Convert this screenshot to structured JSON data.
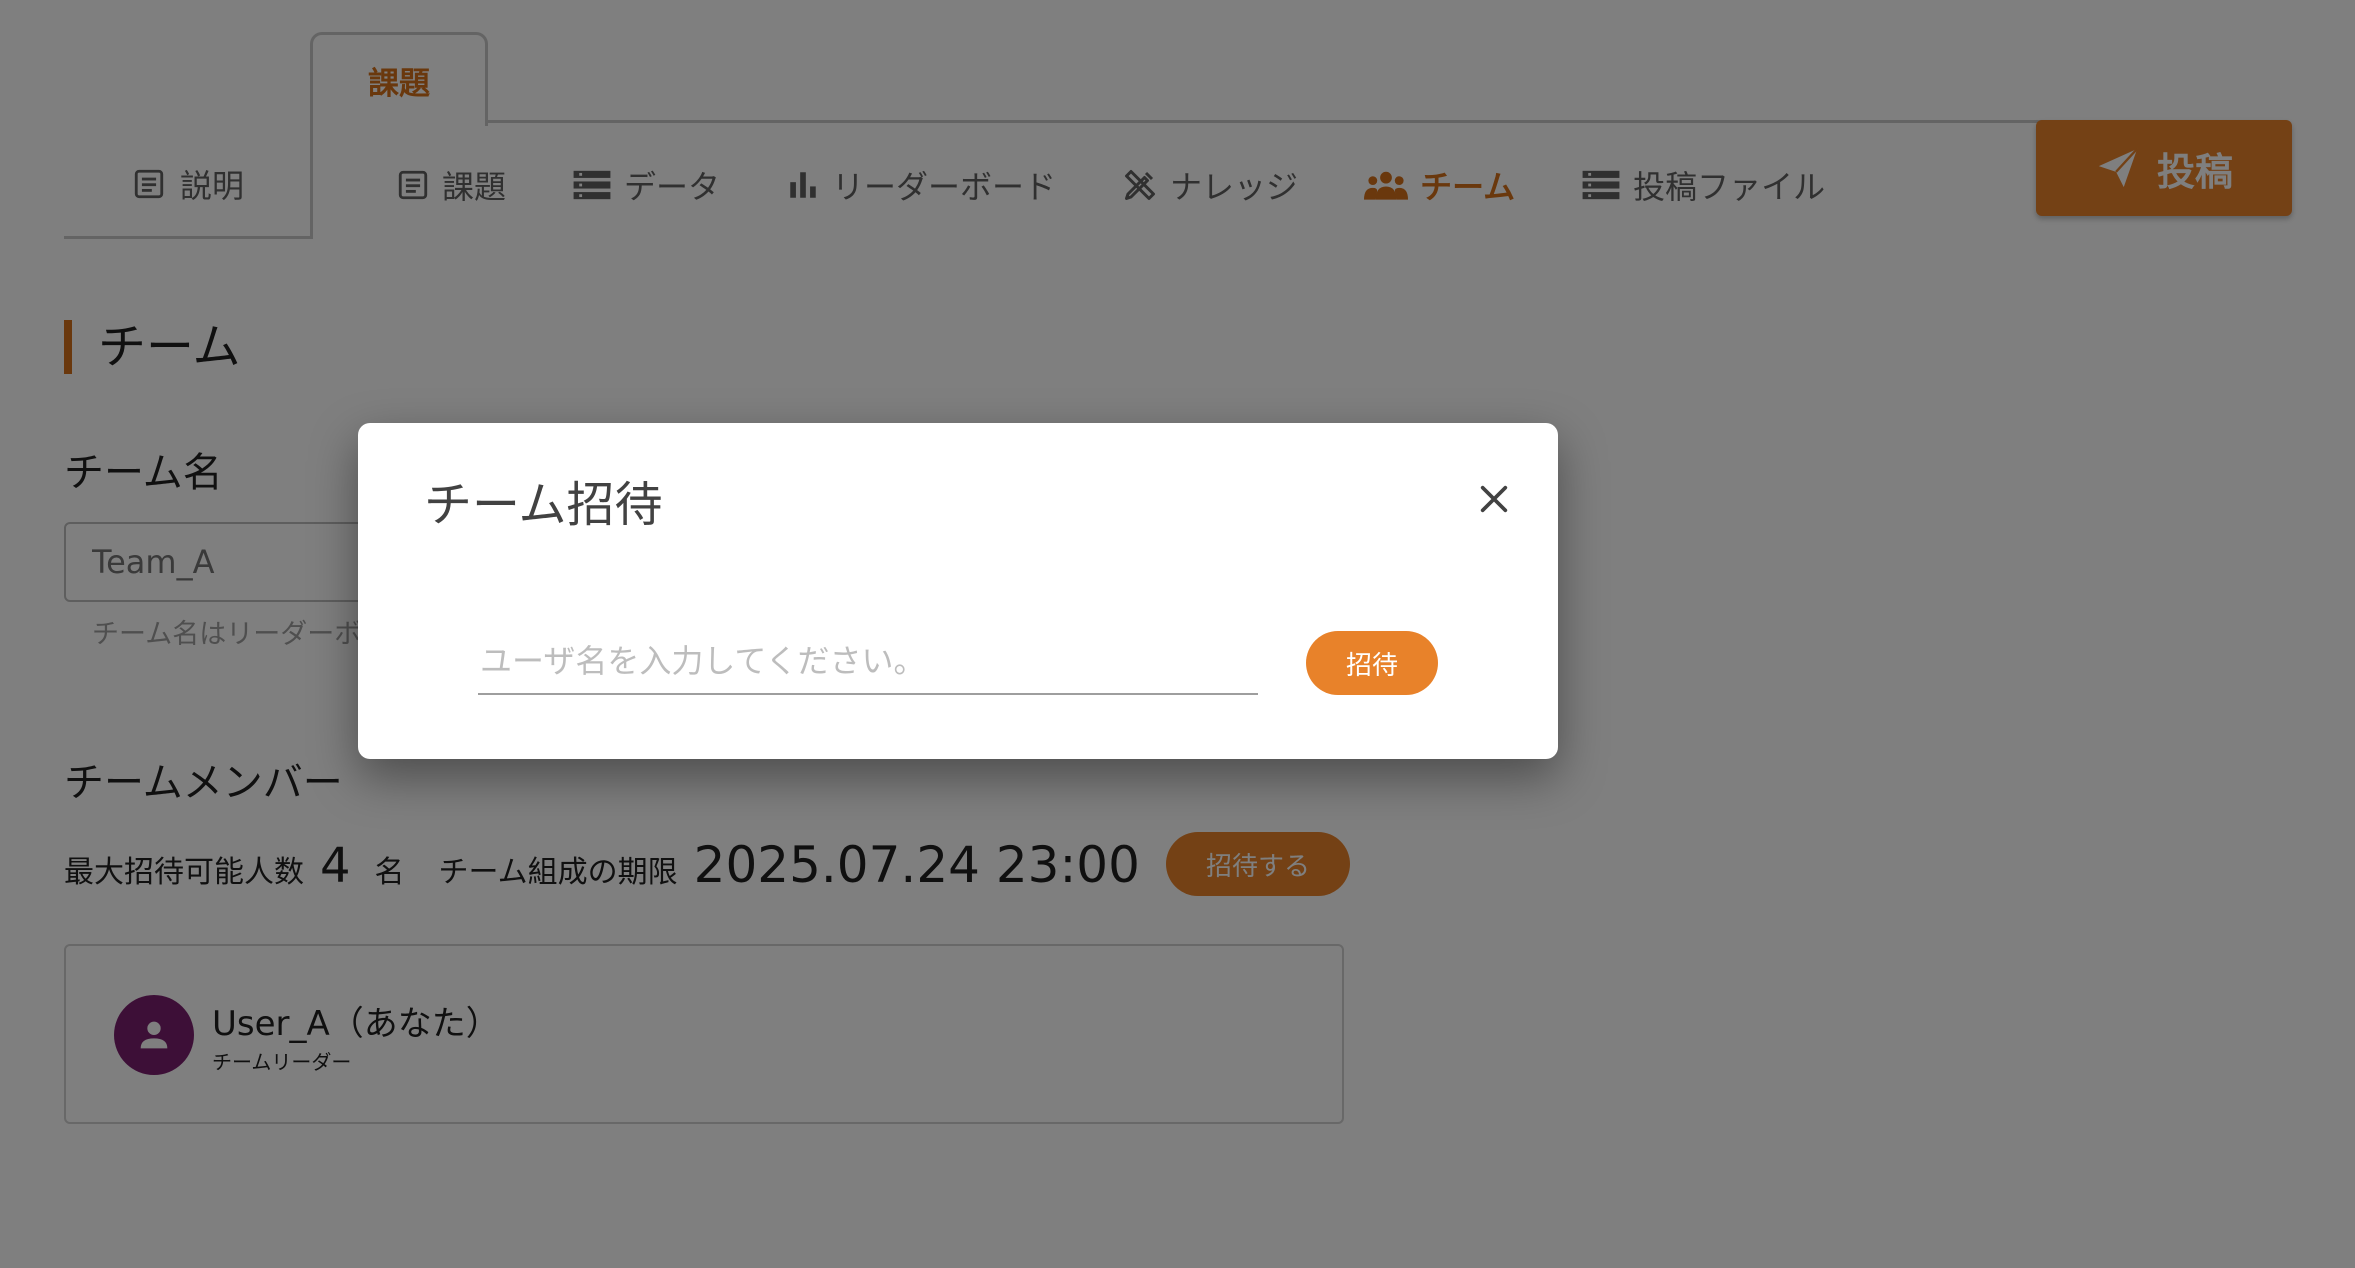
{
  "tabs": {
    "explain_label": "説明",
    "task_label": "課題",
    "subtabs": [
      {
        "label": "課題",
        "icon": "document-icon"
      },
      {
        "label": "データ",
        "icon": "list-icon"
      },
      {
        "label": "リーダーボード",
        "icon": "bar-chart-icon"
      },
      {
        "label": "ナレッジ",
        "icon": "pencil-ruler-icon"
      },
      {
        "label": "チーム",
        "icon": "team-icon",
        "active": true
      },
      {
        "label": "投稿ファイル",
        "icon": "list-icon"
      }
    ],
    "post_label": "投稿"
  },
  "team": {
    "section_title": "チーム",
    "name_label": "チーム名",
    "name_value": "Team_A",
    "name_hint": "チーム名はリーダーボ",
    "members_label": "チームメンバー",
    "max_invite_label": "最大招待可能人数",
    "max_invite_count": "4",
    "max_invite_unit": "名",
    "deadline_label": "チーム組成の期限",
    "deadline_value": "2025.07.24 23:00",
    "invite_button_label": "招待する",
    "members": [
      {
        "name": "User_A（あなた）",
        "role": "チームリーダー"
      }
    ]
  },
  "modal": {
    "title": "チーム招待",
    "input_placeholder": "ユーザ名を入力してください。",
    "submit_label": "招待"
  },
  "colors": {
    "accent": "#e8822a",
    "accent_text": "#d4711a",
    "avatar": "#7b1f6e"
  }
}
